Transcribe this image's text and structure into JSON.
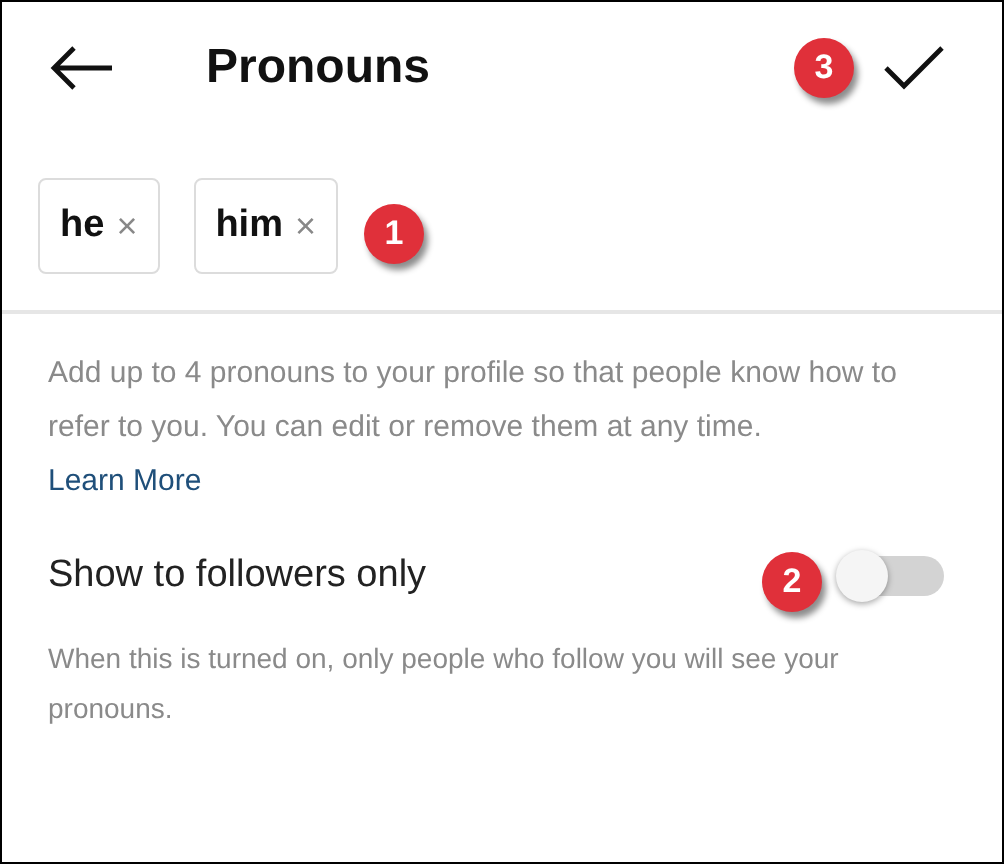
{
  "header": {
    "title": "Pronouns",
    "badge": "3"
  },
  "pronouns": [
    {
      "label": "he",
      "remove": "×"
    },
    {
      "label": "him",
      "remove": "×"
    }
  ],
  "pronouns_badge": "1",
  "description": "Add up to 4 pronouns to your profile so that people know how to refer to you. You can edit or remove them at any time.",
  "learn_more": "Learn More",
  "setting": {
    "label": "Show to followers only",
    "on": false,
    "badge": "2",
    "note": "When this is turned on, only people who follow you will see your pronouns."
  }
}
